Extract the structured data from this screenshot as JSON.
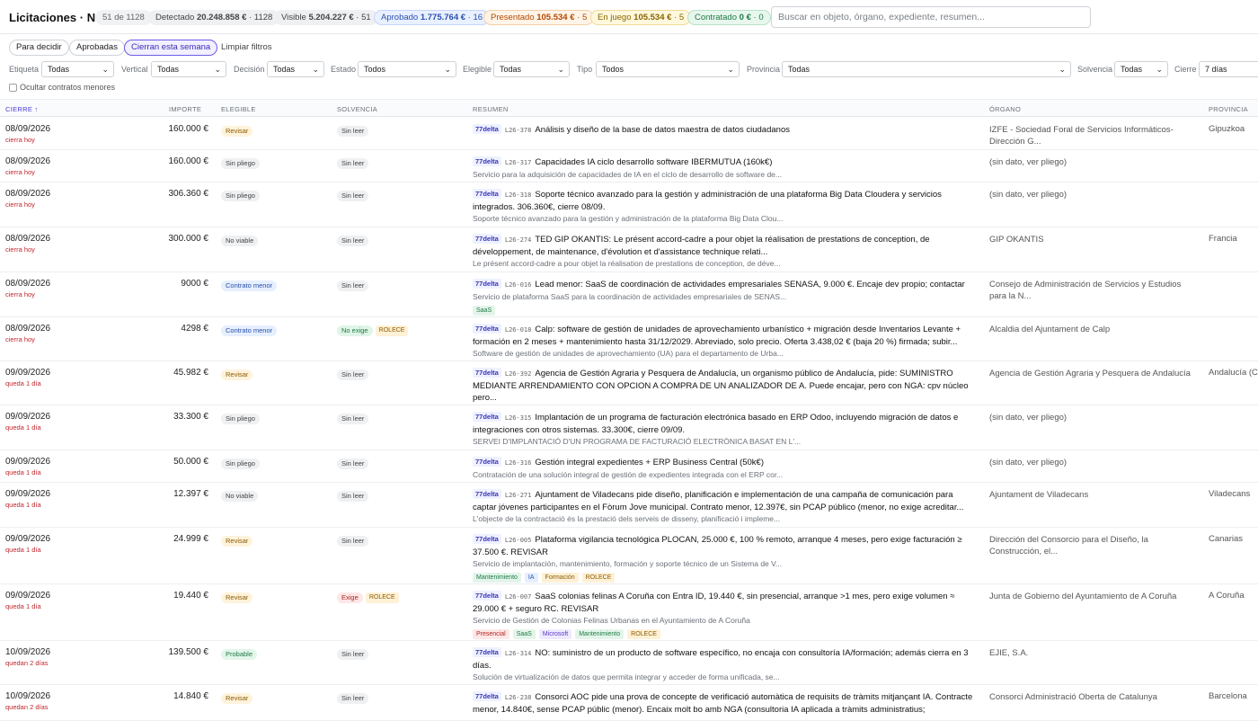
{
  "header": {
    "title": "Licitaciones · NGA",
    "count": "51 de 1128",
    "pills": [
      {
        "label": "Detectado",
        "value": "20.248.858 €",
        "count": "· 1128"
      },
      {
        "label": "Visible",
        "value": "5.204.227 €",
        "count": "· 51"
      },
      {
        "label": "Aprobado",
        "value": "1.775.764 €",
        "count": "· 16"
      },
      {
        "label": "Presentado",
        "value": "105.534 €",
        "count": "· 5"
      },
      {
        "label": "En juego",
        "value": "105.534 €",
        "count": "· 5"
      },
      {
        "label": "Contratado",
        "value": "0 €",
        "count": "· 0"
      }
    ],
    "search_placeholder": "Buscar en objeto, órgano, expediente, resumen..."
  },
  "quick_filters": [
    "Para decidir",
    "Aprobadas",
    "Cierran esta semana"
  ],
  "clear_filters": "Limpiar filtros",
  "filters": [
    {
      "label": "Etiqueta",
      "value": "Todas"
    },
    {
      "label": "Vertical",
      "value": "Todas"
    },
    {
      "label": "Decisión",
      "value": "Todas"
    },
    {
      "label": "Estado",
      "value": "Todos"
    },
    {
      "label": "Elegible",
      "value": "Todas"
    },
    {
      "label": "Tipo",
      "value": "Todos"
    },
    {
      "label": "Provincia",
      "value": "Todas"
    },
    {
      "label": "Solvencia",
      "value": "Todas"
    },
    {
      "label": "Cierre",
      "value": "7 días"
    }
  ],
  "hide_minor_label": "Ocultar contratos menores",
  "columns": {
    "cierre": "CIERRE",
    "sort_icon": "↑",
    "importe": "IMPORTE",
    "elegible": "ELEGIBLE",
    "solvencia": "SOLVENCIA",
    "resumen": "RESUMEN",
    "organo": "ÓRGANO",
    "provincia": "PROVINCIA"
  },
  "rows": [
    {
      "date": "08/09/2026",
      "rel": "cierra hoy",
      "importe": "160.000 €",
      "elegible": "Revisar",
      "solvencia": "Sin leer",
      "agency": "77delta",
      "code": "L26-378",
      "title": "Análisis y diseño de la base de datos maestra de datos ciudadanos",
      "sub": "",
      "tags": [],
      "organo": "IZFE - Sociedad Foral de Servicios Informáticos-Dirección G...",
      "provincia": "Gipuzkoa"
    },
    {
      "date": "08/09/2026",
      "rel": "cierra hoy",
      "importe": "160.000 €",
      "elegible": "Sin pliego",
      "solvencia": "Sin leer",
      "agency": "77delta",
      "code": "L26-317",
      "title": "Capacidades IA ciclo desarrollo software IBERMUTUA (160k€)",
      "sub": "Servicio para la adquisición de capacidades de IA en el ciclo de desarrollo de software de...",
      "tags": [],
      "organo": "(sin dato, ver pliego)",
      "provincia": ""
    },
    {
      "date": "08/09/2026",
      "rel": "cierra hoy",
      "importe": "306.360 €",
      "elegible": "Sin pliego",
      "solvencia": "Sin leer",
      "agency": "77delta",
      "code": "L26-318",
      "title": "Soporte técnico avanzado para la gestión y administración de una plataforma Big Data Cloudera y servicios integrados. 306.360€, cierre 08/09.",
      "sub": "Soporte técnico avanzado para la gestión y administración de la plataforma Big Data Clou...",
      "tags": [],
      "organo": "(sin dato, ver pliego)",
      "provincia": ""
    },
    {
      "date": "08/09/2026",
      "rel": "cierra hoy",
      "importe": "300.000 €",
      "elegible": "No viable",
      "solvencia": "Sin leer",
      "agency": "77delta",
      "code": "L26-274",
      "title": "TED GIP OKANTIS: Le présent accord-cadre a pour objet la réalisation de prestations de conception, de développement, de maintenance, d'évolution et d'assistance technique relati...",
      "sub": "Le présent accord-cadre a pour objet la réalisation de prestations de conception, de déve...",
      "tags": [],
      "organo": "GIP OKANTIS",
      "provincia": "Francia"
    },
    {
      "date": "08/09/2026",
      "rel": "cierra hoy",
      "importe": "9000 €",
      "elegible": "Contrato menor",
      "solvencia": "Sin leer",
      "agency": "77delta",
      "code": "L26-016",
      "title": "Lead menor: SaaS de coordinación de actividades empresariales SENASA, 9.000 €. Encaje dev propio; contactar",
      "sub": "Servicio de plataforma SaaS para la coordinación de actividades empresariales de SENAS...",
      "tags": [
        "SaaS"
      ],
      "organo": "Consejo de Administración de Servicios y Estudios para la N...",
      "provincia": ""
    },
    {
      "date": "08/09/2026",
      "rel": "cierra hoy",
      "importe": "4298 €",
      "elegible": "Contrato menor",
      "solvencia": "No exige",
      "rolece": "ROLECE",
      "agency": "77delta",
      "code": "L26-018",
      "title": "Calp: software de gestión de unidades de aprovechamiento urbanístico + migración desde Inventarios Levante + formación en 2 meses + mantenimiento hasta 31/12/2029. Abreviado, solo precio. Oferta 3.438,02 € (baja 20 %) firmada; subir...",
      "sub": "Software de gestión de unidades de aprovechamiento (UA) para el departamento de Urba...",
      "tags": [],
      "organo": "Alcaldia del Ajuntament de Calp",
      "provincia": ""
    },
    {
      "date": "09/09/2026",
      "rel": "queda 1 día",
      "importe": "45.982 €",
      "elegible": "Revisar",
      "solvencia": "Sin leer",
      "agency": "77delta",
      "code": "L26-392",
      "title": "Agencia de Gestión Agraria y Pesquera de Andalucía, un organismo público de Andalucía, pide: SUMINISTRO MEDIANTE ARRENDAMIENTO CON OPCION A COMPRA DE UN ANALIZADOR DE A. Puede encajar, pero con NGA: cpv núcleo pero...",
      "sub": "SUMINISTRO MEDIANTE ARRENDAMIENTO CON OPCION A COMPRA DE UN ANALIZADO...",
      "tags": [],
      "organo": "Agencia de Gestión Agraria y Pesquera de Andalucía",
      "provincia": "Andalucía (Ca"
    },
    {
      "date": "09/09/2026",
      "rel": "queda 1 día",
      "importe": "33.300 €",
      "elegible": "Sin pliego",
      "solvencia": "Sin leer",
      "agency": "77delta",
      "code": "L26-315",
      "title": "Implantación de un programa de facturación electrónica basado en ERP Odoo, incluyendo migración de datos e integraciones con otros sistemas. 33.300€, cierre 09/09.",
      "sub": "SERVEI D'IMPLANTACIÓ D'UN PROGRAMA DE FACTURACIÓ ELECTRÒNICA BASAT EN L'...",
      "tags": [],
      "organo": "(sin dato, ver pliego)",
      "provincia": ""
    },
    {
      "date": "09/09/2026",
      "rel": "queda 1 día",
      "importe": "50.000 €",
      "elegible": "Sin pliego",
      "solvencia": "Sin leer",
      "agency": "77delta",
      "code": "L26-316",
      "title": "Gestión integral expedientes + ERP Business Central (50k€)",
      "sub": "Contratación de una solución integral de gestión de expedientes integrada con el ERP cor...",
      "tags": [],
      "organo": "(sin dato, ver pliego)",
      "provincia": ""
    },
    {
      "date": "09/09/2026",
      "rel": "queda 1 día",
      "importe": "12.397 €",
      "elegible": "No viable",
      "solvencia": "Sin leer",
      "agency": "77delta",
      "code": "L26-271",
      "title": "Ajuntament de Viladecans pide diseño, planificación e implementación de una campaña de comunicación para captar jóvenes participantes en el Fòrum Jove municipal. Contrato menor, 12.397€, sin PCAP público (menor, no exige acreditar...",
      "sub": "L'objecte de la contractació és la prestació dels serveis de disseny, planificació i impleme...",
      "tags": [],
      "organo": "Ajuntament de Viladecans",
      "provincia": "Viladecans"
    },
    {
      "date": "09/09/2026",
      "rel": "queda 1 día",
      "importe": "24.999 €",
      "elegible": "Revisar",
      "solvencia": "Sin leer",
      "agency": "77delta",
      "code": "L26-005",
      "title": "Plataforma vigilancia tecnológica PLOCAN, 25.000 €, 100 % remoto, arranque 4 meses, pero exige facturación ≥ 37.500 €. REVISAR",
      "sub": "Servicio de implantación, mantenimiento, formación y soporte técnico de un Sistema de V...",
      "tags": [
        "Mantenimiento",
        "IA",
        "Formación",
        "ROLECE"
      ],
      "organo": "Dirección del Consorcio para el Diseño, la Construcción, el...",
      "provincia": "Canarias"
    },
    {
      "date": "09/09/2026",
      "rel": "queda 1 día",
      "importe": "19.440 €",
      "elegible": "Revisar",
      "solvencia": "Exige",
      "rolece": "ROLECE",
      "agency": "77delta",
      "code": "L26-007",
      "title": "SaaS colonias felinas A Coruña con Entra ID, 19.440 €, sin presencial, arranque >1 mes, pero exige volumen ≈ 29.000 € + seguro RC. REVISAR",
      "sub": "Servicio de Gestión de Colonias Felinas Urbanas en el Ayuntamiento de A Coruña",
      "tags": [
        "Presencial",
        "SaaS",
        "Microsoft",
        "Mantenimiento",
        "ROLECE"
      ],
      "organo": "Junta de Gobierno del Ayuntamiento de A Coruña",
      "provincia": "A Coruña"
    },
    {
      "date": "10/09/2026",
      "rel": "quedan 2 días",
      "importe": "139.500 €",
      "elegible": "Probable",
      "solvencia": "Sin leer",
      "agency": "77delta",
      "code": "L26-314",
      "title": "NO: suministro de un producto de software específico, no encaja con consultoría IA/formación; además cierra en 3 días.",
      "sub": "Solución de virtualización de datos que permita integrar y acceder de forma unificada, se...",
      "tags": [],
      "organo": "EJIE, S.A.",
      "provincia": ""
    },
    {
      "date": "10/09/2026",
      "rel": "quedan 2 días",
      "importe": "14.840 €",
      "elegible": "Revisar",
      "solvencia": "Sin leer",
      "agency": "77delta",
      "code": "L26-238",
      "title": "Consorci AOC pide una prova de concepte de verificació automàtica de requisits de tràmits mitjançant IA. Contracte menor, 14.840€, sense PCAP públic (menor). Encaix molt bo amb NGA (consultoria IA aplicada a tràmits administratius;",
      "sub": "",
      "tags": [],
      "organo": "Consorci Administració Oberta de Catalunya",
      "provincia": "Barcelona"
    }
  ]
}
